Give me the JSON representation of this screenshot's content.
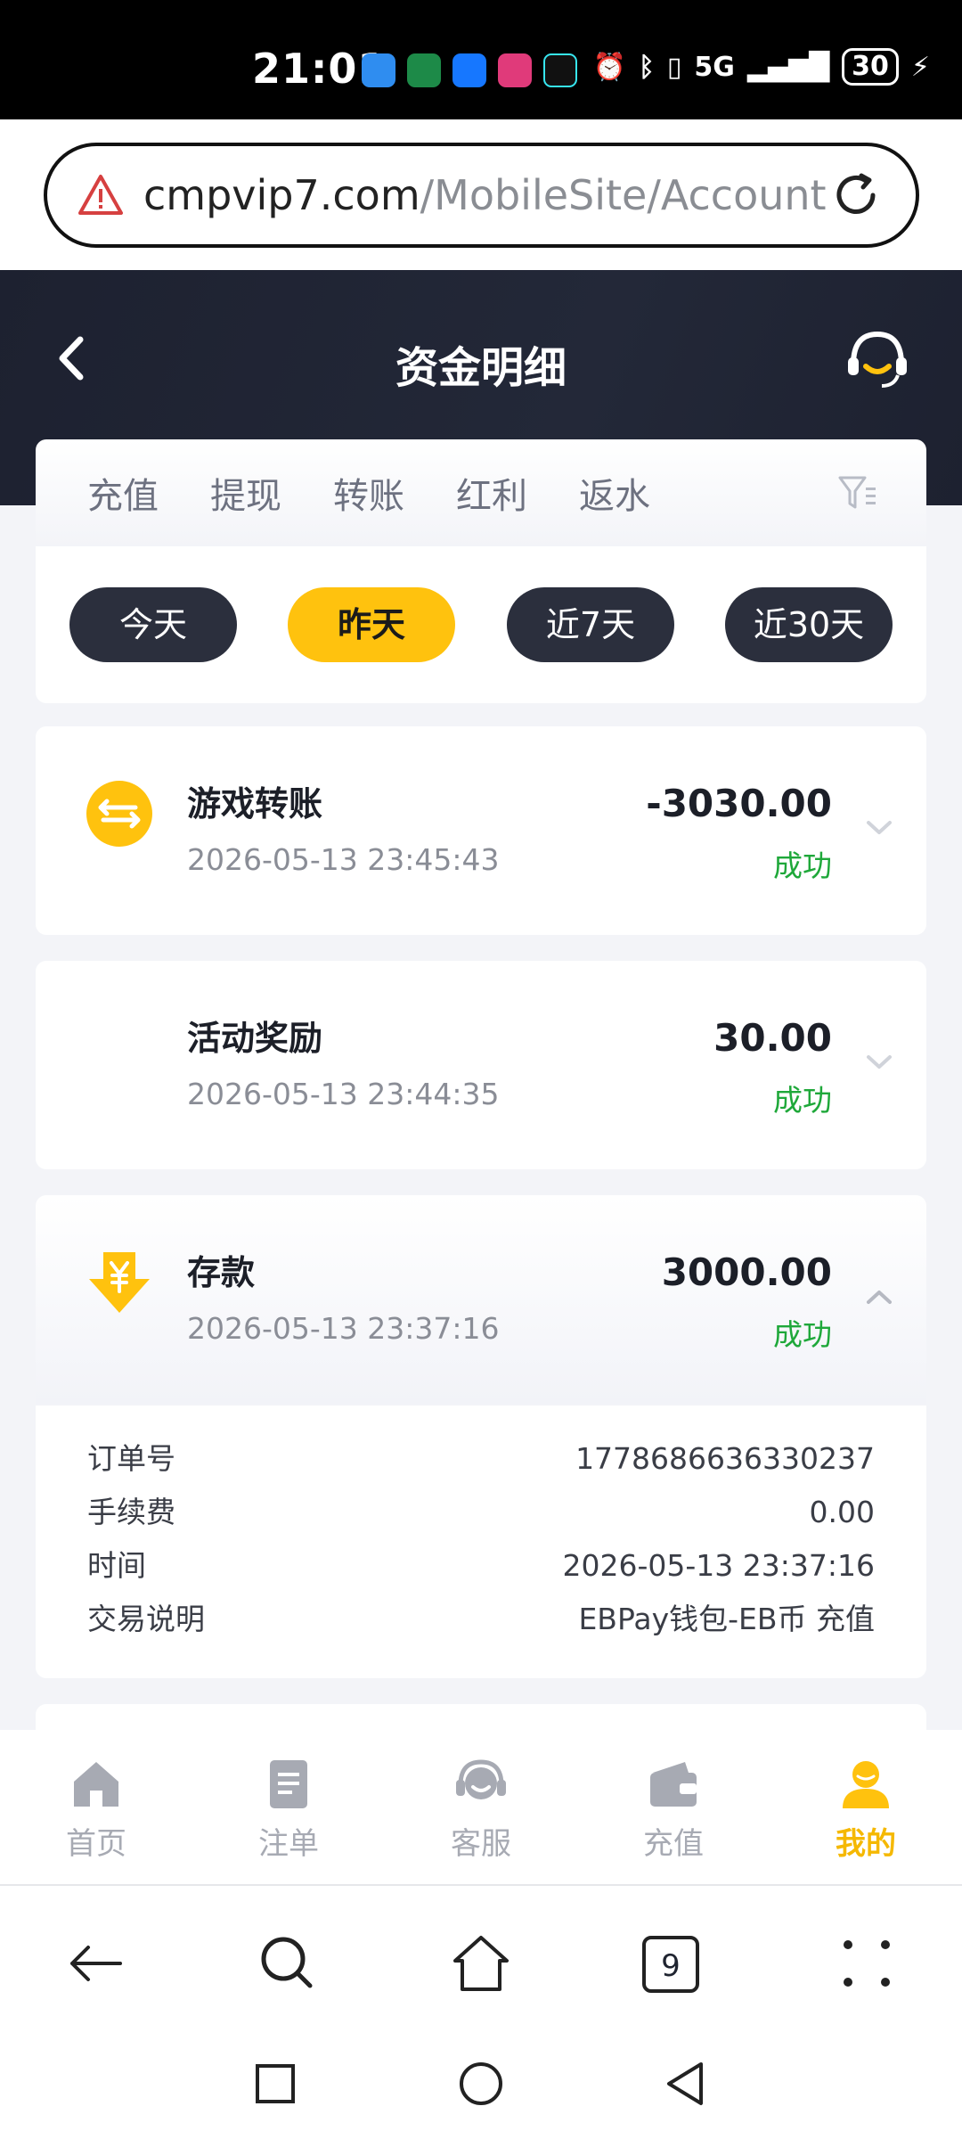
{
  "status_bar": {
    "time": "21:01",
    "network": "5G",
    "battery": "30"
  },
  "browser": {
    "url_domain": "cmpvip7.com",
    "url_path": "/MobileSite/Account",
    "tab_count": "9"
  },
  "header": {
    "title": "资金明细"
  },
  "type_tabs": [
    "充值",
    "提现",
    "转账",
    "红利",
    "返水"
  ],
  "periods": [
    {
      "label": "今天",
      "active": false
    },
    {
      "label": "昨天",
      "active": true
    },
    {
      "label": "近7天",
      "active": false
    },
    {
      "label": "近30天",
      "active": false
    }
  ],
  "transactions": [
    {
      "name": "游戏转账",
      "date": "2026-05-13 23:45:43",
      "amount": "-3030.00",
      "status": "成功",
      "icon": "transfer-icon"
    },
    {
      "name": "活动奖励",
      "date": "2026-05-13 23:44:35",
      "amount": "30.00",
      "status": "成功",
      "icon": ""
    },
    {
      "name": "存款",
      "date": "2026-05-13 23:37:16",
      "amount": "3000.00",
      "status": "成功",
      "icon": "deposit-icon",
      "expanded": true
    }
  ],
  "details": {
    "order_label": "订单号",
    "order_value": "1778686636330237",
    "fee_label": "手续费",
    "fee_value": "0.00",
    "time_label": "时间",
    "time_value": "2026-05-13 23:37:16",
    "desc_label": "交易说明",
    "desc_value": "EBPay钱包-EB币 充值"
  },
  "bottom_nav": [
    {
      "label": "首页",
      "icon": "home-icon",
      "active": false
    },
    {
      "label": "注单",
      "icon": "betslip-icon",
      "active": false
    },
    {
      "label": "客服",
      "icon": "support-icon",
      "active": false
    },
    {
      "label": "充值",
      "icon": "wallet-icon",
      "active": false
    },
    {
      "label": "我的",
      "icon": "profile-icon",
      "active": true
    }
  ],
  "colors": {
    "accent": "#ffc20e",
    "header_bg": "#1d2130",
    "success": "#1fa83a"
  }
}
